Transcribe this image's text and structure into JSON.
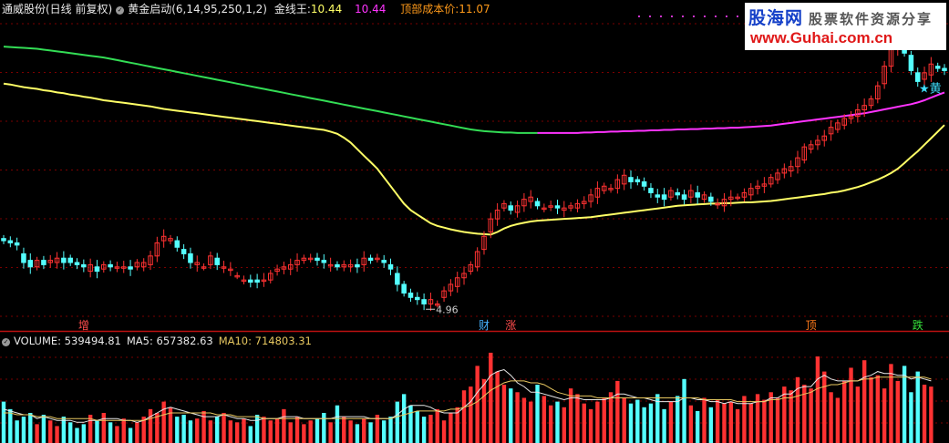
{
  "header": {
    "title": "通威股份(日线 前复权)",
    "indicator": "黄金启动(6,14,95,250,1,2)",
    "jxw_label": "金线王:",
    "jxw_value": "10.44",
    "pink_value": "10.44",
    "top_cost_label": "顶部成本价:",
    "top_cost_value": "11.07"
  },
  "volume_header": {
    "volume": "VOLUME: 539494.81",
    "ma5": "MA5: 657382.63",
    "ma10": "MA10: 714803.31"
  },
  "watermark": {
    "site_name": "股海网",
    "subtitle": "股票软件资源分享",
    "url": "www.Guhai.com.cn"
  },
  "markers": [
    {
      "text": "增",
      "color": "#ff4d4d",
      "index": 12
    },
    {
      "text": "财",
      "color": "#47b2ff",
      "index": 72
    },
    {
      "text": "涨",
      "color": "#ff4d4d",
      "index": 76
    },
    {
      "text": "顶",
      "color": "#ff7a1a",
      "index": 121
    },
    {
      "text": "跌",
      "color": "#35e03a",
      "index": 137
    }
  ],
  "colors": {
    "background": "#000000",
    "up": "#ff3232",
    "down": "#54ffff",
    "gold_line": "#ffff66",
    "green_line": "#33dd55",
    "magenta_line": "#ff33ff",
    "grid": "#7a0000",
    "separator": "#bb1111",
    "vol_ma5": "#e8e8e8",
    "vol_ma10": "#e8c860"
  },
  "chart_data": {
    "type": "candlestick",
    "price_range": [
      4.6,
      11.6
    ],
    "low_annotation": "4.96",
    "star_label": "黄",
    "candles": [
      [
        6.55,
        6.5
      ],
      [
        6.5,
        6.45
      ],
      [
        6.45,
        6.4
      ],
      [
        6.2,
        6.0
      ],
      [
        6.05,
        5.9
      ],
      [
        5.9,
        6.05
      ],
      [
        6.05,
        5.95
      ],
      [
        6.0,
        6.05
      ],
      [
        6.0,
        6.1
      ],
      [
        6.1,
        6.0
      ],
      [
        6.1,
        6.0
      ],
      [
        6.0,
        5.95
      ],
      [
        5.95,
        5.9
      ],
      [
        5.8,
        5.95
      ],
      [
        5.9,
        5.8
      ],
      [
        5.85,
        5.95
      ],
      [
        5.95,
        5.9
      ],
      [
        5.9,
        5.9
      ],
      [
        5.9,
        5.9
      ],
      [
        5.9,
        5.85
      ],
      [
        5.9,
        6.0
      ],
      [
        5.9,
        6.0
      ],
      [
        5.95,
        6.15
      ],
      [
        6.15,
        6.45
      ],
      [
        6.5,
        6.6
      ],
      [
        6.5,
        6.55
      ],
      [
        6.5,
        6.35
      ],
      [
        6.3,
        6.2
      ],
      [
        6.2,
        6.0
      ],
      [
        5.95,
        6.0
      ],
      [
        5.9,
        5.9
      ],
      [
        5.95,
        6.15
      ],
      [
        6.1,
        5.95
      ],
      [
        5.9,
        5.9
      ],
      [
        5.85,
        5.85
      ],
      [
        5.7,
        5.7
      ],
      [
        5.6,
        5.6
      ],
      [
        5.6,
        5.55
      ],
      [
        5.6,
        5.55
      ],
      [
        5.6,
        5.6
      ],
      [
        5.6,
        5.75
      ],
      [
        5.8,
        5.85
      ],
      [
        5.85,
        5.9
      ],
      [
        5.85,
        5.95
      ],
      [
        5.95,
        6.05
      ],
      [
        6.05,
        6.1
      ],
      [
        6.1,
        6.1
      ],
      [
        6.1,
        6.05
      ],
      [
        6.05,
        6.0
      ],
      [
        5.95,
        5.95
      ],
      [
        5.95,
        5.9
      ],
      [
        5.9,
        5.95
      ],
      [
        5.9,
        5.95
      ],
      [
        5.95,
        5.9
      ],
      [
        5.95,
        6.1
      ],
      [
        6.1,
        6.05
      ],
      [
        6.1,
        6.1
      ],
      [
        6.05,
        6.0
      ],
      [
        5.95,
        5.85
      ],
      [
        5.75,
        5.5
      ],
      [
        5.5,
        5.3
      ],
      [
        5.3,
        5.2
      ],
      [
        5.2,
        5.15
      ],
      [
        5.15,
        5.05
      ],
      [
        5.05,
        5.15
      ],
      [
        5.05,
        5.05
      ],
      [
        5.2,
        5.35
      ],
      [
        5.35,
        5.5
      ],
      [
        5.45,
        5.65
      ],
      [
        5.65,
        5.75
      ],
      [
        5.8,
        5.95
      ],
      [
        5.9,
        6.25
      ],
      [
        6.3,
        6.6
      ],
      [
        6.7,
        7.0
      ],
      [
        7.0,
        7.2
      ],
      [
        7.25,
        7.35
      ],
      [
        7.3,
        7.2
      ],
      [
        7.15,
        7.3
      ],
      [
        7.3,
        7.45
      ],
      [
        7.4,
        7.5
      ],
      [
        7.4,
        7.3
      ],
      [
        7.25,
        7.25
      ],
      [
        7.3,
        7.3
      ],
      [
        7.3,
        7.25
      ],
      [
        7.2,
        7.25
      ],
      [
        7.25,
        7.3
      ],
      [
        7.25,
        7.35
      ],
      [
        7.35,
        7.4
      ],
      [
        7.4,
        7.55
      ],
      [
        7.5,
        7.7
      ],
      [
        7.65,
        7.75
      ],
      [
        7.7,
        7.7
      ],
      [
        7.7,
        7.9
      ],
      [
        7.8,
        8.0
      ],
      [
        7.95,
        7.85
      ],
      [
        7.9,
        7.85
      ],
      [
        7.85,
        7.75
      ],
      [
        7.7,
        7.6
      ],
      [
        7.55,
        7.5
      ],
      [
        7.55,
        7.45
      ],
      [
        7.5,
        7.65
      ],
      [
        7.6,
        7.55
      ],
      [
        7.55,
        7.45
      ],
      [
        7.5,
        7.65
      ],
      [
        7.6,
        7.5
      ],
      [
        7.45,
        7.55
      ],
      [
        7.5,
        7.4
      ],
      [
        7.35,
        7.35
      ],
      [
        7.3,
        7.45
      ],
      [
        7.45,
        7.5
      ],
      [
        7.5,
        7.5
      ],
      [
        7.5,
        7.6
      ],
      [
        7.55,
        7.7
      ],
      [
        7.7,
        7.75
      ],
      [
        7.75,
        7.8
      ],
      [
        7.8,
        7.95
      ],
      [
        7.9,
        8.05
      ],
      [
        8.05,
        8.15
      ],
      [
        8.1,
        8.2
      ],
      [
        8.2,
        8.4
      ],
      [
        8.35,
        8.65
      ],
      [
        8.6,
        8.7
      ],
      [
        8.7,
        8.8
      ],
      [
        8.8,
        8.9
      ],
      [
        8.95,
        9.1
      ],
      [
        9.05,
        9.2
      ],
      [
        9.15,
        9.3
      ],
      [
        9.3,
        9.35
      ],
      [
        9.35,
        9.5
      ],
      [
        9.5,
        9.6
      ],
      [
        9.6,
        9.75
      ],
      [
        9.75,
        10.05
      ],
      [
        10.1,
        10.5
      ],
      [
        10.5,
        10.9
      ],
      [
        10.9,
        11.05
      ],
      [
        10.95,
        10.8
      ],
      [
        10.75,
        10.4
      ],
      [
        10.35,
        10.15
      ],
      [
        10.2,
        10.35
      ],
      [
        10.3,
        10.55
      ],
      [
        10.5,
        10.45
      ],
      [
        10.45,
        10.4
      ]
    ],
    "ma_gold": [
      10.1,
      10.08,
      10.05,
      10.02,
      10.0,
      9.98,
      9.95,
      9.93,
      9.9,
      9.88,
      9.85,
      9.83,
      9.8,
      9.78,
      9.75,
      9.72,
      9.7,
      9.68,
      9.66,
      9.64,
      9.62,
      9.6,
      9.58,
      9.55,
      9.52,
      9.5,
      9.48,
      9.46,
      9.44,
      9.42,
      9.4,
      9.38,
      9.36,
      9.34,
      9.32,
      9.3,
      9.28,
      9.26,
      9.24,
      9.22,
      9.2,
      9.18,
      9.16,
      9.14,
      9.12,
      9.1,
      9.08,
      9.06,
      9.04,
      9.0,
      8.95,
      8.86,
      8.75,
      8.6,
      8.45,
      8.3,
      8.15,
      7.95,
      7.75,
      7.55,
      7.35,
      7.2,
      7.1,
      7.0,
      6.9,
      6.84,
      6.8,
      6.76,
      6.73,
      6.7,
      6.68,
      6.66,
      6.65,
      6.64,
      6.7,
      6.78,
      6.84,
      6.88,
      6.91,
      6.94,
      6.96,
      6.97,
      6.98,
      6.99,
      7.0,
      7.01,
      7.02,
      7.03,
      7.04,
      7.06,
      7.08,
      7.1,
      7.12,
      7.14,
      7.16,
      7.18,
      7.2,
      7.22,
      7.24,
      7.26,
      7.28,
      7.3,
      7.31,
      7.32,
      7.33,
      7.34,
      7.35,
      7.35,
      7.36,
      7.36,
      7.37,
      7.38,
      7.38,
      7.39,
      7.4,
      7.41,
      7.43,
      7.45,
      7.47,
      7.49,
      7.51,
      7.53,
      7.55,
      7.57,
      7.6,
      7.62,
      7.65,
      7.69,
      7.73,
      7.78,
      7.84,
      7.9,
      7.97,
      8.05,
      8.15,
      8.28,
      8.42,
      8.55,
      8.7,
      8.85,
      9.0,
      9.15,
      9.28
    ],
    "ma_long": [
      10.95,
      10.94,
      10.93,
      10.92,
      10.91,
      10.9,
      10.88,
      10.86,
      10.84,
      10.82,
      10.8,
      10.78,
      10.76,
      10.74,
      10.72,
      10.7,
      10.67,
      10.64,
      10.61,
      10.58,
      10.55,
      10.52,
      10.49,
      10.46,
      10.43,
      10.4,
      10.37,
      10.34,
      10.31,
      10.28,
      10.25,
      10.22,
      10.19,
      10.16,
      10.13,
      10.1,
      10.07,
      10.04,
      10.01,
      9.98,
      9.95,
      9.92,
      9.89,
      9.86,
      9.83,
      9.8,
      9.77,
      9.74,
      9.71,
      9.68,
      9.65,
      9.62,
      9.59,
      9.56,
      9.53,
      9.5,
      9.47,
      9.44,
      9.41,
      9.38,
      9.35,
      9.32,
      9.29,
      9.26,
      9.23,
      9.2,
      9.17,
      9.14,
      9.11,
      9.08,
      9.05,
      9.03,
      9.01,
      9.0,
      8.99,
      8.98,
      8.98,
      8.97,
      8.97,
      8.97,
      8.97,
      8.97,
      8.97,
      8.97,
      8.97,
      8.97,
      8.97,
      8.98,
      8.98,
      8.99,
      8.99,
      9.0,
      9.0,
      9.01,
      9.01,
      9.02,
      9.02,
      9.03,
      9.03,
      9.04,
      9.04,
      9.05,
      9.05,
      9.06,
      9.06,
      9.07,
      9.07,
      9.08,
      9.08,
      9.09,
      9.09,
      9.1,
      9.11,
      9.12,
      9.13,
      9.14,
      9.16,
      9.18,
      9.2,
      9.22,
      9.24,
      9.26,
      9.28,
      9.3,
      9.32,
      9.34,
      9.36,
      9.38,
      9.4,
      9.42,
      9.45,
      9.48,
      9.51,
      9.54,
      9.57,
      9.6,
      9.63,
      9.67,
      9.72,
      9.78,
      9.84,
      9.9,
      9.95,
      10.0
    ],
    "magenta_from_index": 80,
    "volume": [
      22,
      18,
      12,
      14,
      16,
      10,
      15,
      12,
      9,
      14,
      11,
      8,
      10,
      15,
      12,
      16,
      11,
      9,
      13,
      8,
      11,
      14,
      18,
      16,
      22,
      19,
      14,
      15,
      12,
      13,
      17,
      12,
      14,
      16,
      12,
      11,
      13,
      9,
      15,
      14,
      12,
      13,
      18,
      11,
      14,
      10,
      12,
      13,
      16,
      11,
      20,
      14,
      12,
      10,
      13,
      11,
      15,
      12,
      14,
      22,
      26,
      20,
      17,
      14,
      15,
      18,
      12,
      16,
      19,
      28,
      30,
      41,
      34,
      48,
      38,
      31,
      29,
      27,
      24,
      22,
      31,
      25,
      20,
      22,
      19,
      29,
      26,
      21,
      18,
      22,
      24,
      27,
      33,
      24,
      21,
      23,
      19,
      21,
      26,
      18,
      22,
      25,
      34,
      20,
      17,
      24,
      19,
      23,
      21,
      22,
      18,
      25,
      21,
      26,
      23,
      27,
      24,
      30,
      28,
      35,
      31,
      29,
      46,
      38,
      27,
      24,
      33,
      40,
      30,
      44,
      35,
      36,
      29,
      42,
      33,
      41,
      27,
      38,
      31,
      30
    ],
    "vol_ma5": [
      18,
      17,
      16,
      15,
      15,
      13,
      14,
      13,
      12,
      12,
      12,
      11,
      11,
      12,
      12,
      13,
      13,
      13,
      12,
      12,
      11,
      12,
      14,
      16,
      18,
      19,
      18,
      17,
      16,
      15,
      14,
      14,
      14,
      15,
      14,
      13,
      13,
      12,
      12,
      13,
      13,
      13,
      14,
      14,
      14,
      13,
      13,
      13,
      13,
      13,
      14,
      14,
      14,
      14,
      14,
      13,
      13,
      13,
      13,
      15,
      18,
      20,
      20,
      20,
      19,
      17,
      16,
      16,
      16,
      19,
      22,
      27,
      31,
      36,
      38,
      39,
      36,
      32,
      30,
      27,
      27,
      26,
      25,
      24,
      23,
      24,
      24,
      23,
      23,
      23,
      23,
      24,
      26,
      26,
      25,
      24,
      24,
      23,
      22,
      22,
      22,
      22,
      24,
      24,
      23,
      23,
      22,
      22,
      21,
      22,
      21,
      21,
      21,
      22,
      22,
      24,
      24,
      26,
      26,
      29,
      30,
      30,
      34,
      36,
      34,
      33,
      33,
      33,
      33,
      35,
      36,
      38,
      37,
      37,
      36,
      36,
      34,
      35,
      34,
      33
    ],
    "vol_ma10": [
      16,
      16,
      15,
      15,
      15,
      14,
      14,
      14,
      13,
      13,
      13,
      13,
      13,
      13,
      12,
      12,
      12,
      12,
      12,
      12,
      12,
      12,
      13,
      14,
      15,
      16,
      16,
      16,
      16,
      16,
      16,
      16,
      15,
      15,
      15,
      14,
      14,
      14,
      14,
      13,
      13,
      13,
      13,
      13,
      13,
      13,
      13,
      13,
      13,
      13,
      13,
      13,
      13,
      13,
      13,
      13,
      13,
      13,
      13,
      14,
      15,
      16,
      17,
      17,
      17,
      17,
      17,
      18,
      18,
      19,
      20,
      22,
      25,
      28,
      30,
      32,
      33,
      33,
      33,
      32,
      32,
      31,
      29,
      27,
      26,
      25,
      25,
      25,
      25,
      24,
      24,
      24,
      24,
      24,
      24,
      24,
      24,
      24,
      24,
      24,
      24,
      24,
      24,
      24,
      24,
      23,
      23,
      23,
      23,
      23,
      22,
      22,
      22,
      22,
      22,
      23,
      23,
      24,
      24,
      25,
      26,
      27,
      29,
      30,
      31,
      31,
      32,
      33,
      33,
      34,
      34,
      35,
      35,
      35,
      35,
      35,
      35,
      35,
      35,
      34
    ]
  }
}
